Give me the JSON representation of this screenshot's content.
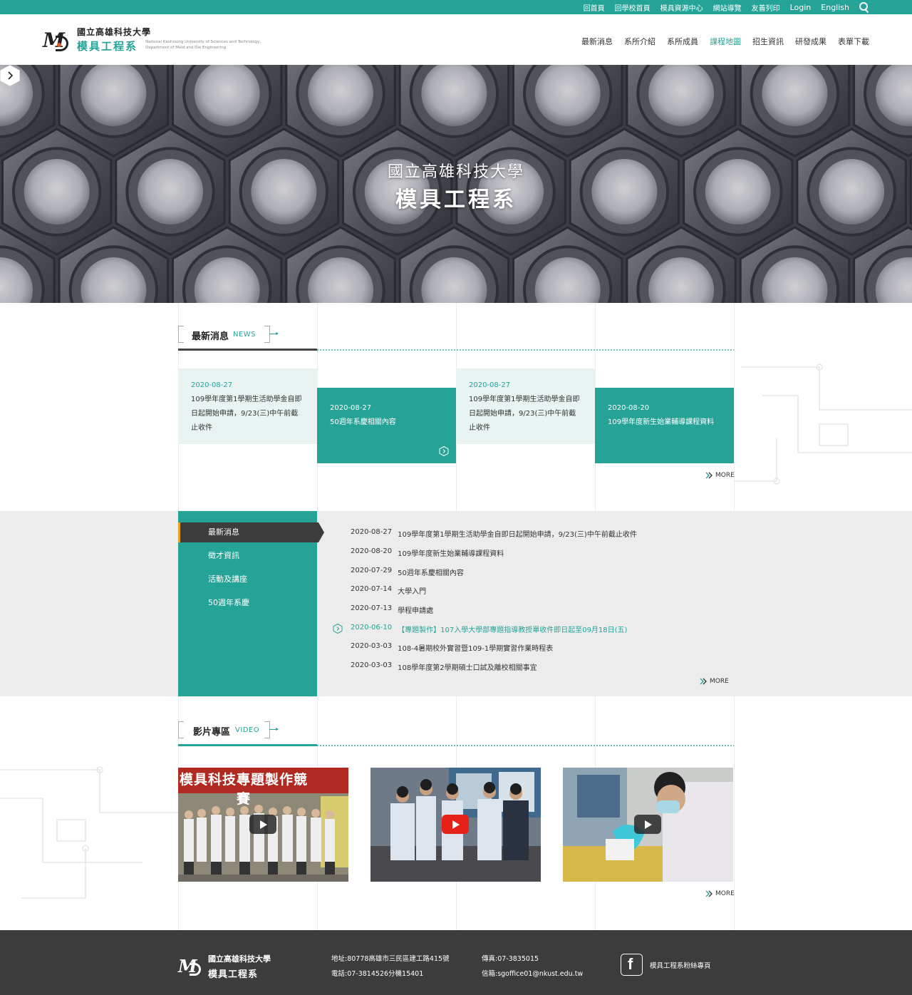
{
  "topbar": {
    "links": [
      "回首頁",
      "回學校首頁",
      "模具資源中心",
      "網站導覽",
      "友善列印",
      "Login",
      "English"
    ]
  },
  "logo": {
    "cn_line1": "國立高雄科技大學",
    "cn_line2": "模具工程系",
    "en_line1": "National Kaohsiung University of Sciences and Technology,",
    "en_line2": "Department of Mold and Die Engineering"
  },
  "nav": {
    "items": [
      "最新消息",
      "系所介紹",
      "系所成員",
      "課程地圖",
      "招生資訊",
      "研發成果",
      "表單下載"
    ],
    "active_index": 3
  },
  "hero": {
    "line1": "國立高雄科技大學",
    "line2": "模具工程系"
  },
  "news_section": {
    "title": "最新消息",
    "subtitle": "NEWS",
    "more": "MORE",
    "cards": [
      {
        "date": "2020-08-27",
        "text": "109學年度第1學期生活助學金自即日起開始申請，9/23(三)中午前截止收件"
      },
      {
        "date": "2020-08-27",
        "text": "50週年系慶相關內容"
      },
      {
        "date": "2020-08-27",
        "text": "109學年度第1學期生活助學金自即日起開始申請，9/23(三)中午前截止收件"
      },
      {
        "date": "2020-08-20",
        "text": "109學年度新生始業輔導課程資料"
      }
    ]
  },
  "news_list": {
    "tabs": [
      "最新消息",
      "徵才資訊",
      "活動及講座",
      "50週年系慶"
    ],
    "active_tab": 0,
    "items": [
      {
        "date": "2020-08-27",
        "title": "109學年度第1學期生活助學金自即日起開始申請，9/23(三)中午前截止收件"
      },
      {
        "date": "2020-08-20",
        "title": "109學年度新生始業輔導課程資料"
      },
      {
        "date": "2020-07-29",
        "title": "50週年系慶相關內容"
      },
      {
        "date": "2020-07-14",
        "title": "大學入門"
      },
      {
        "date": "2020-07-13",
        "title": "學程申請處"
      },
      {
        "date": "2020-06-10",
        "title": "【專題製作】107入學大學部專題指導教授單收件即日起至09月18日(五)"
      },
      {
        "date": "2020-03-03",
        "title": "108-4暑期校外實習暨109-1學期實習作業時程表"
      },
      {
        "date": "2020-03-03",
        "title": "108學年度第2學期碩士口試及離校相關事宜"
      }
    ],
    "highlight_index": 5,
    "more": "MORE"
  },
  "video_section": {
    "title": "影片專區",
    "subtitle": "VIDEO",
    "more": "MORE",
    "banner_text": "模具科技專題製作競賽"
  },
  "footer": {
    "logo_line1": "國立高雄科技大學",
    "logo_line2": "模具工程系",
    "address": "地址:80778高雄市三民區建工路415號",
    "phone": "電話:07-3814526分機15401",
    "fax": "傳真:07-3835015",
    "email": "信箱:sgoffice01@nkust.edu.tw",
    "fb_label": "模具工程系粉絲專頁"
  },
  "colors": {
    "accent": "#26a397",
    "dark": "#3c3c3c",
    "highlight": "#e8a21c"
  }
}
